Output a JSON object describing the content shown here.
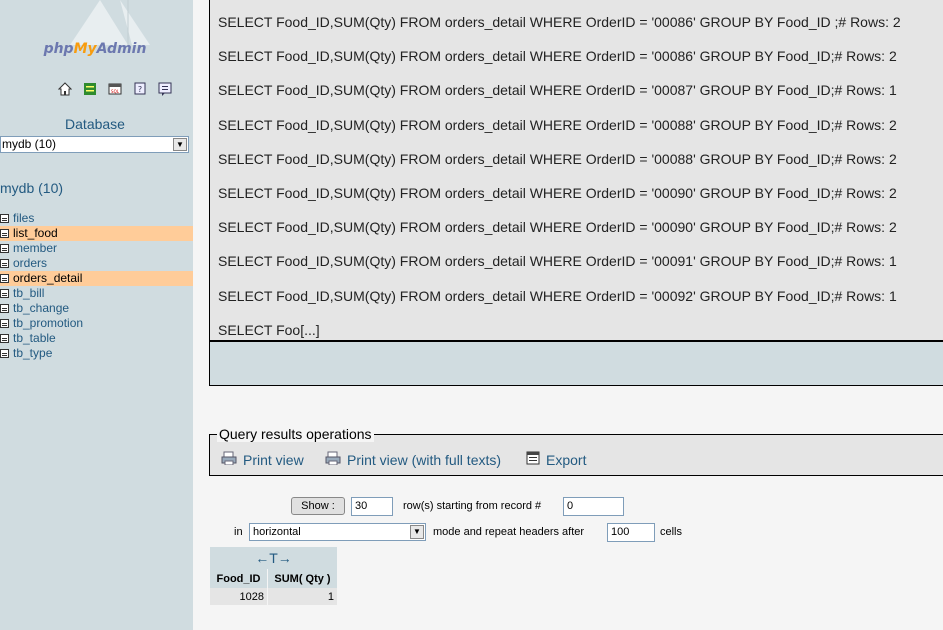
{
  "sidebar": {
    "logo": {
      "php": "php",
      "my": "My",
      "admin": "Admin"
    },
    "quick_icons": [
      "home-icon",
      "exit-icon",
      "sql-icon",
      "docs-icon",
      "help-icon"
    ],
    "database_label": "Database",
    "database_select_value": "mydb (10)",
    "database_heading": "mydb (10)",
    "tables": [
      {
        "name": "files",
        "highlighted": false
      },
      {
        "name": "list_food",
        "highlighted": true
      },
      {
        "name": "member",
        "highlighted": false
      },
      {
        "name": "orders",
        "highlighted": false
      },
      {
        "name": "orders_detail",
        "highlighted": true
      },
      {
        "name": "tb_bill",
        "highlighted": false
      },
      {
        "name": "tb_change",
        "highlighted": false
      },
      {
        "name": "tb_promotion",
        "highlighted": false
      },
      {
        "name": "tb_table",
        "highlighted": false
      },
      {
        "name": "tb_type",
        "highlighted": false
      }
    ]
  },
  "query": {
    "lines": [
      "SELECT Food_ID,SUM(Qty) FROM orders_detail WHERE OrderID = '00086' GROUP BY Food_ID ;# Rows: 2",
      "SELECT Food_ID,SUM(Qty) FROM orders_detail WHERE OrderID = '00086' GROUP BY Food_ID;# Rows: 2",
      "SELECT Food_ID,SUM(Qty) FROM orders_detail WHERE OrderID = '00087' GROUP BY Food_ID;# Rows: 1",
      "SELECT Food_ID,SUM(Qty) FROM orders_detail WHERE OrderID = '00088' GROUP BY Food_ID;# Rows: 2",
      "SELECT Food_ID,SUM(Qty) FROM orders_detail WHERE OrderID = '00088' GROUP BY Food_ID;# Rows: 2",
      "SELECT Food_ID,SUM(Qty) FROM orders_detail WHERE OrderID = '00090' GROUP BY Food_ID;# Rows: 2",
      "SELECT Food_ID,SUM(Qty) FROM orders_detail WHERE OrderID = '00090' GROUP BY Food_ID;# Rows: 2",
      "SELECT Food_ID,SUM(Qty) FROM orders_detail WHERE OrderID = '00091' GROUP BY Food_ID;# Rows: 1",
      "SELECT Food_ID,SUM(Qty) FROM orders_detail WHERE OrderID = '00092' GROUP BY Food_ID;# Rows: 1",
      "SELECT Foo[...]"
    ]
  },
  "operations": {
    "legend": "Query results operations",
    "print_view": "Print view",
    "print_view_full": "Print view (with full texts)",
    "export": "Export"
  },
  "navigation": {
    "show_button": "Show :",
    "rows_value": "30",
    "rows_label": "row(s) starting from record #",
    "start_value": "0",
    "in_label": "in",
    "mode_value": "horizontal",
    "mode_label": "mode and repeat headers after",
    "repeat_value": "100",
    "cells_label": "cells"
  },
  "results": {
    "sort_arrows": "←T→",
    "columns": [
      "Food_ID",
      "SUM( Qty )"
    ],
    "rows": [
      [
        "1028",
        "1"
      ]
    ]
  },
  "colors": {
    "sidebar_bg": "#d0dce0",
    "highlight": "#ffcc99",
    "link": "#235a81"
  }
}
